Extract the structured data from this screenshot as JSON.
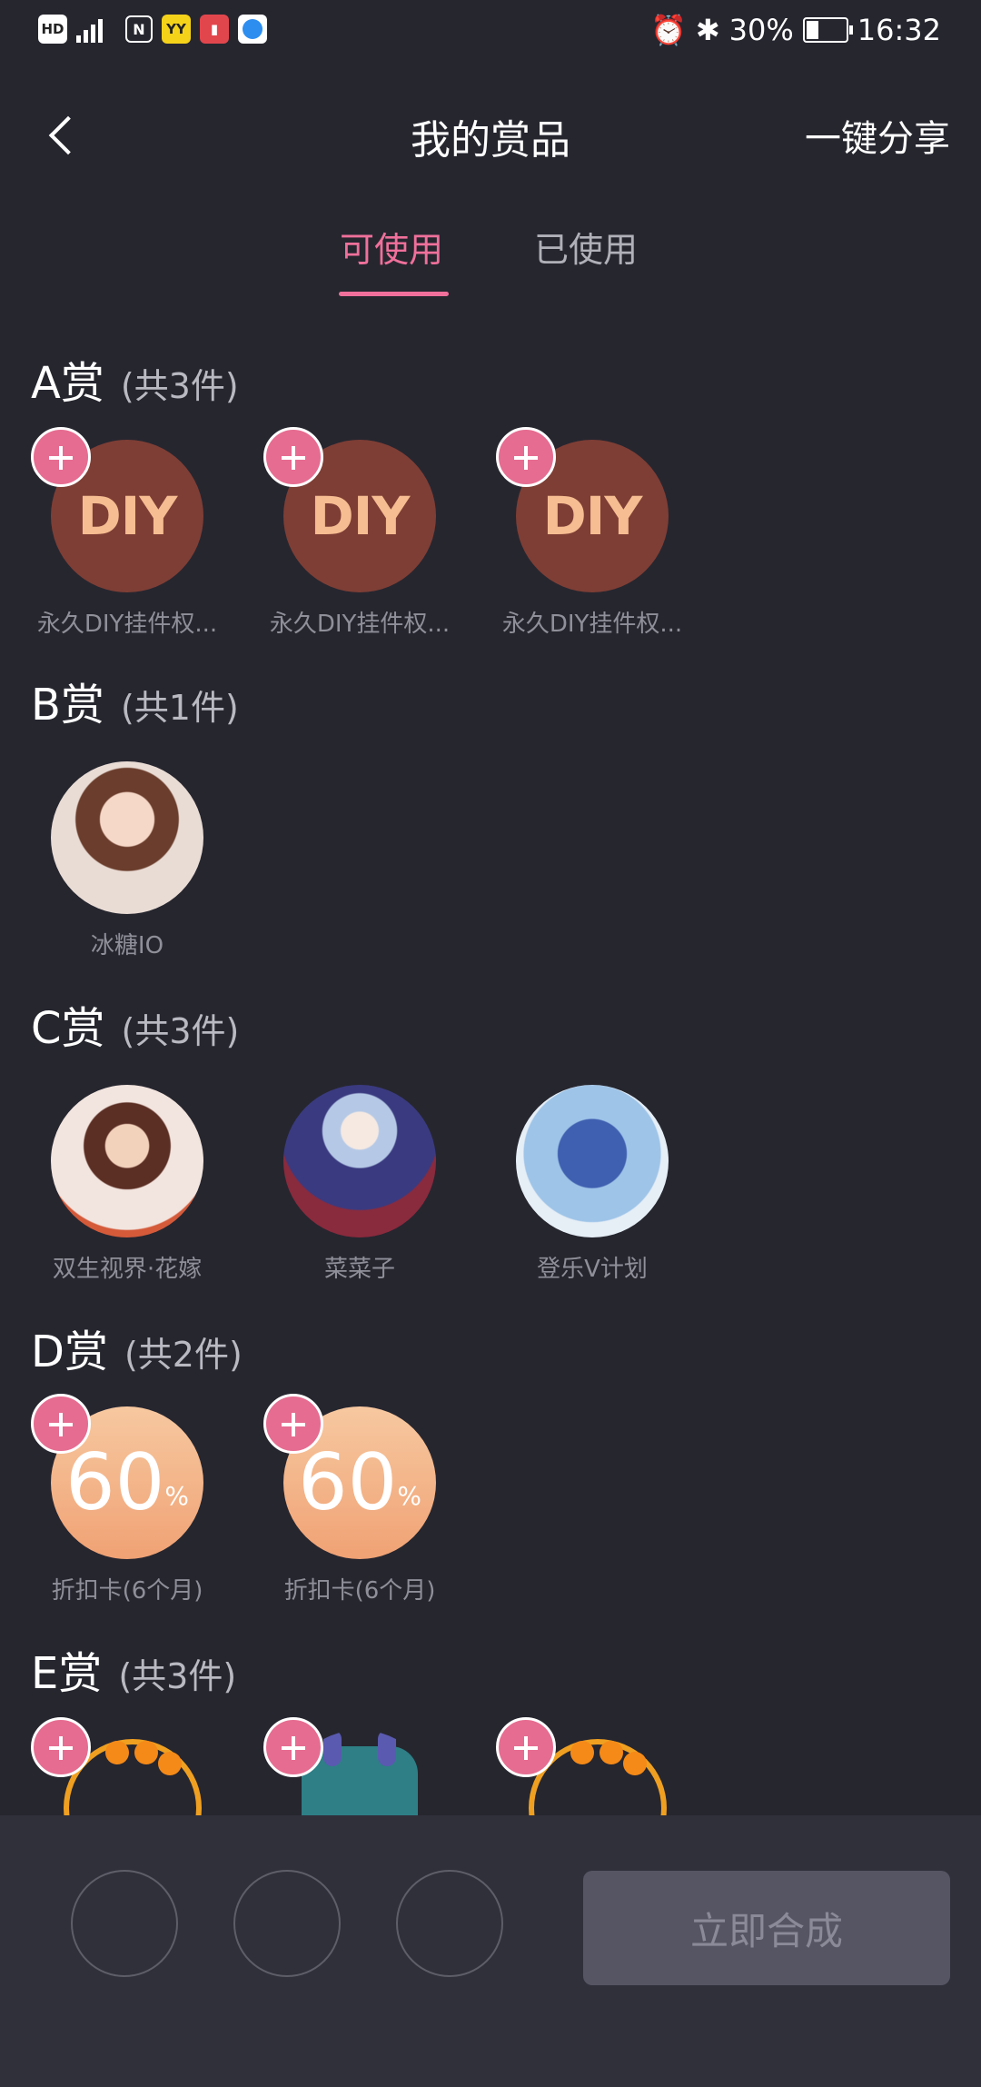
{
  "status_bar": {
    "left_icons": [
      "HD",
      "4G",
      "N",
      "YY",
      "book",
      "blue-app"
    ],
    "battery": "30%",
    "battery_level": 0.3,
    "time": "16:32"
  },
  "nav": {
    "title": "我的赏品",
    "share": "一键分享"
  },
  "tabs": [
    {
      "label": "可使用",
      "active": true
    },
    {
      "label": "已使用",
      "active": false
    }
  ],
  "sections": [
    {
      "title": "A赏",
      "count": "(共3件)",
      "items": [
        {
          "label": "永久DIY挂件权...",
          "art": "DIY"
        },
        {
          "label": "永久DIY挂件权...",
          "art": "DIY"
        },
        {
          "label": "永久DIY挂件权...",
          "art": "DIY"
        }
      ]
    },
    {
      "title": "B赏",
      "count": "(共1件)",
      "items": [
        {
          "label": "冰糖IO"
        }
      ]
    },
    {
      "title": "C赏",
      "count": "(共3件)",
      "items": [
        {
          "label": "双生视界·花嫁"
        },
        {
          "label": "菜菜子"
        },
        {
          "label": "登乐V计划"
        }
      ]
    },
    {
      "title": "D赏",
      "count": "(共2件)",
      "items": [
        {
          "label": "折扣卡(6个月)",
          "value": "60",
          "unit": "%"
        },
        {
          "label": "折扣卡(6个月)",
          "value": "60",
          "unit": "%"
        }
      ]
    },
    {
      "title": "E赏",
      "count": "(共3件)",
      "items": []
    }
  ],
  "bottom": {
    "compose_button": "立即合成"
  },
  "colors": {
    "accent": "#f0709b",
    "background": "#26262f",
    "panel": "#30303b"
  }
}
